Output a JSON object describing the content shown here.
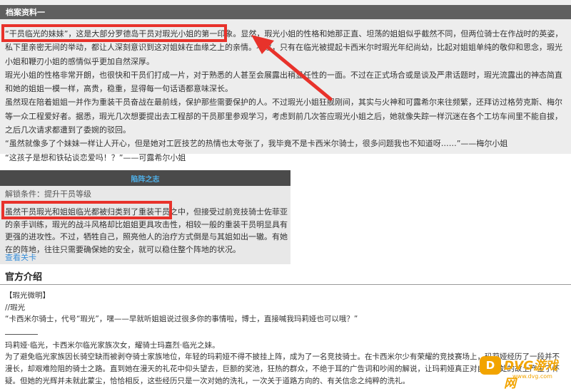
{
  "archive": {
    "title": "档案资料一",
    "paragraphs": [
      "“干员临光的妹妹”，这是大部分罗德岛干员对瑕光小姐的第一印象。显然，瑕光小姐的性格和她那正直、坦荡的姐姐似乎截然不同，但两位骑士在作战时的英姿，私下里亲密无间的举动，都让人深刻意识到这对姐妹在血缘之上的亲情。不过，只有在临光被提起卡西米尔时瑕光年纪尚幼，比起对姐姐单纯的敬仰和思念，瑕光小姐和鞭刃小姐的感情似乎更加自然深厚。",
      "瑕光小姐的性格非常开朗，也很快和干员们打成一片，对于熟悉的人甚至会展露出稍显任性的一面。不过在正式场合或是谈及严肃话题时，瑕光流露出的神态简直和她的姐姐一模一样，高贵，稳重，显得每一句话语都意味深长。",
      "虽然现在陪着姐姐一并作为重装干员奋战在最前线，保护那些需要保护的人。不过瑕光小姐狂舰刚间，其实与火神和可露希尔来往频繁，还拜访过格劳克斯、梅尔等一众工程爱好者。据悉，瑕光几次想要提出去工程部的干员那里参观学习，考虑到前几次答应瑕光小姐之后，她就像失踪一样沉迷在各个工坊车间里不能自拔，之后几次请求都遭到了委婉的驳回。",
      "“虽然就像多了个妹妹一样让人开心，但是她对工匠技艺的热情也太夸张了，我毕竟不是卡西米尔骑士，很多问题我也不知道呀……”——梅尔小姐",
      "“这孩子是想和铁砧谈恋爱吗！？”——可露希尔小姐"
    ]
  },
  "trap": {
    "title": "陷阵之志",
    "condition": "解锁条件：提升干员等级",
    "paragraphs": [
      "虽然干员瑕光和姐姐临光都被归类到了重装干员之中，但接受过前竞技骑士佐菲亚的亲手训练，瑕光的战斗风格却比姐姐更具攻击性，相较一般的重装干员明显具有更强的进攻性。不过，牺牲自己，照亮他人的治疗方式倒是与其姐如出一辙。有她在的阵地，往往只需要确保她的安全，就可以稳住整个阵地的状况。"
    ],
    "link": "查看关卡"
  },
  "official": {
    "title": "官方介绍",
    "tag": "【瑕光微明】",
    "speaker": "//瑕光",
    "quote": "“卡西米尔骑士，代号“瑕光”，嘿——早就听姐姐说过很多你的事情啦，博士，直接喊我玛莉娅也可以哦？”",
    "name_line": "玛莉娅·临光，卡西米尔临光家族次女，耀骑士玛嘉烈·临光之妹。",
    "story": "为了避免临光家族因长骑空缺而被剥夺骑士家族地位，年轻的玛莉娅不得不披挂上阵，成为了一名竞技骑士。在卡西米尔少有荣耀的竞技赛场上，玛莉娅经历了一段并不漫长，却艰难险阻的骑士之路。直到她在漫天的礼花中仰头望去，巨额的奖池，狂热的群众，不绝于耳的广告词和吵闹的解说，让玛莉娅真正对自己身处的故土产生了怀疑。但她的光辉并未就此蒙尘，恰恰相反，这些经历只是一次对她的洗礼，一次关于道路方向的、有关信念之纯粹的洗礼。"
  },
  "watermark": {
    "icon_letter": "D",
    "text": "DVG游戏网",
    "url": "www.dvg.com"
  },
  "colors": {
    "highlight": "#e8322b",
    "archive_header": "#5f5f5f",
    "trap_title": "#4fb0e8",
    "link": "#3a8fd9",
    "watermark": "#f2a400"
  }
}
